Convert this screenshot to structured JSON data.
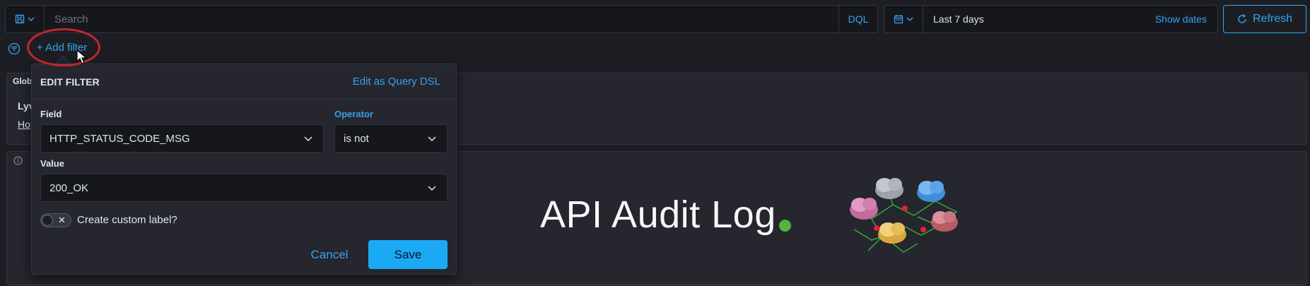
{
  "query_bar": {
    "saved_query_icon": "save-icon",
    "search_placeholder": "Search",
    "language": "DQL"
  },
  "date_picker": {
    "icon": "calendar-icon",
    "range": "Last 7 days",
    "show_dates": "Show dates"
  },
  "refresh": {
    "label": "Refresh",
    "icon": "refresh-icon"
  },
  "filter_row": {
    "add_filter": "+ Add filter",
    "icon": "filter-icon"
  },
  "background_panels": {
    "global_title": "Glob",
    "global_sub": "Lyv",
    "global_link": "Ho",
    "main_title": "API Audit Log"
  },
  "edit_filter": {
    "title": "EDIT FILTER",
    "query_dsl": "Edit as Query DSL",
    "field_label": "Field",
    "field_value": "HTTP_STATUS_CODE_MSG",
    "operator_label": "Operator",
    "operator_value": "is not",
    "value_label": "Value",
    "value_value": "200_OK",
    "custom_label_text": "Create custom label?",
    "custom_label_enabled": false,
    "cancel": "Cancel",
    "save": "Save"
  },
  "colors": {
    "accent": "#36a2ef",
    "primary_button": "#1ba9f5",
    "highlight": "#c0272d",
    "status_dot": "#54b33d",
    "background": "#1d1e24"
  }
}
